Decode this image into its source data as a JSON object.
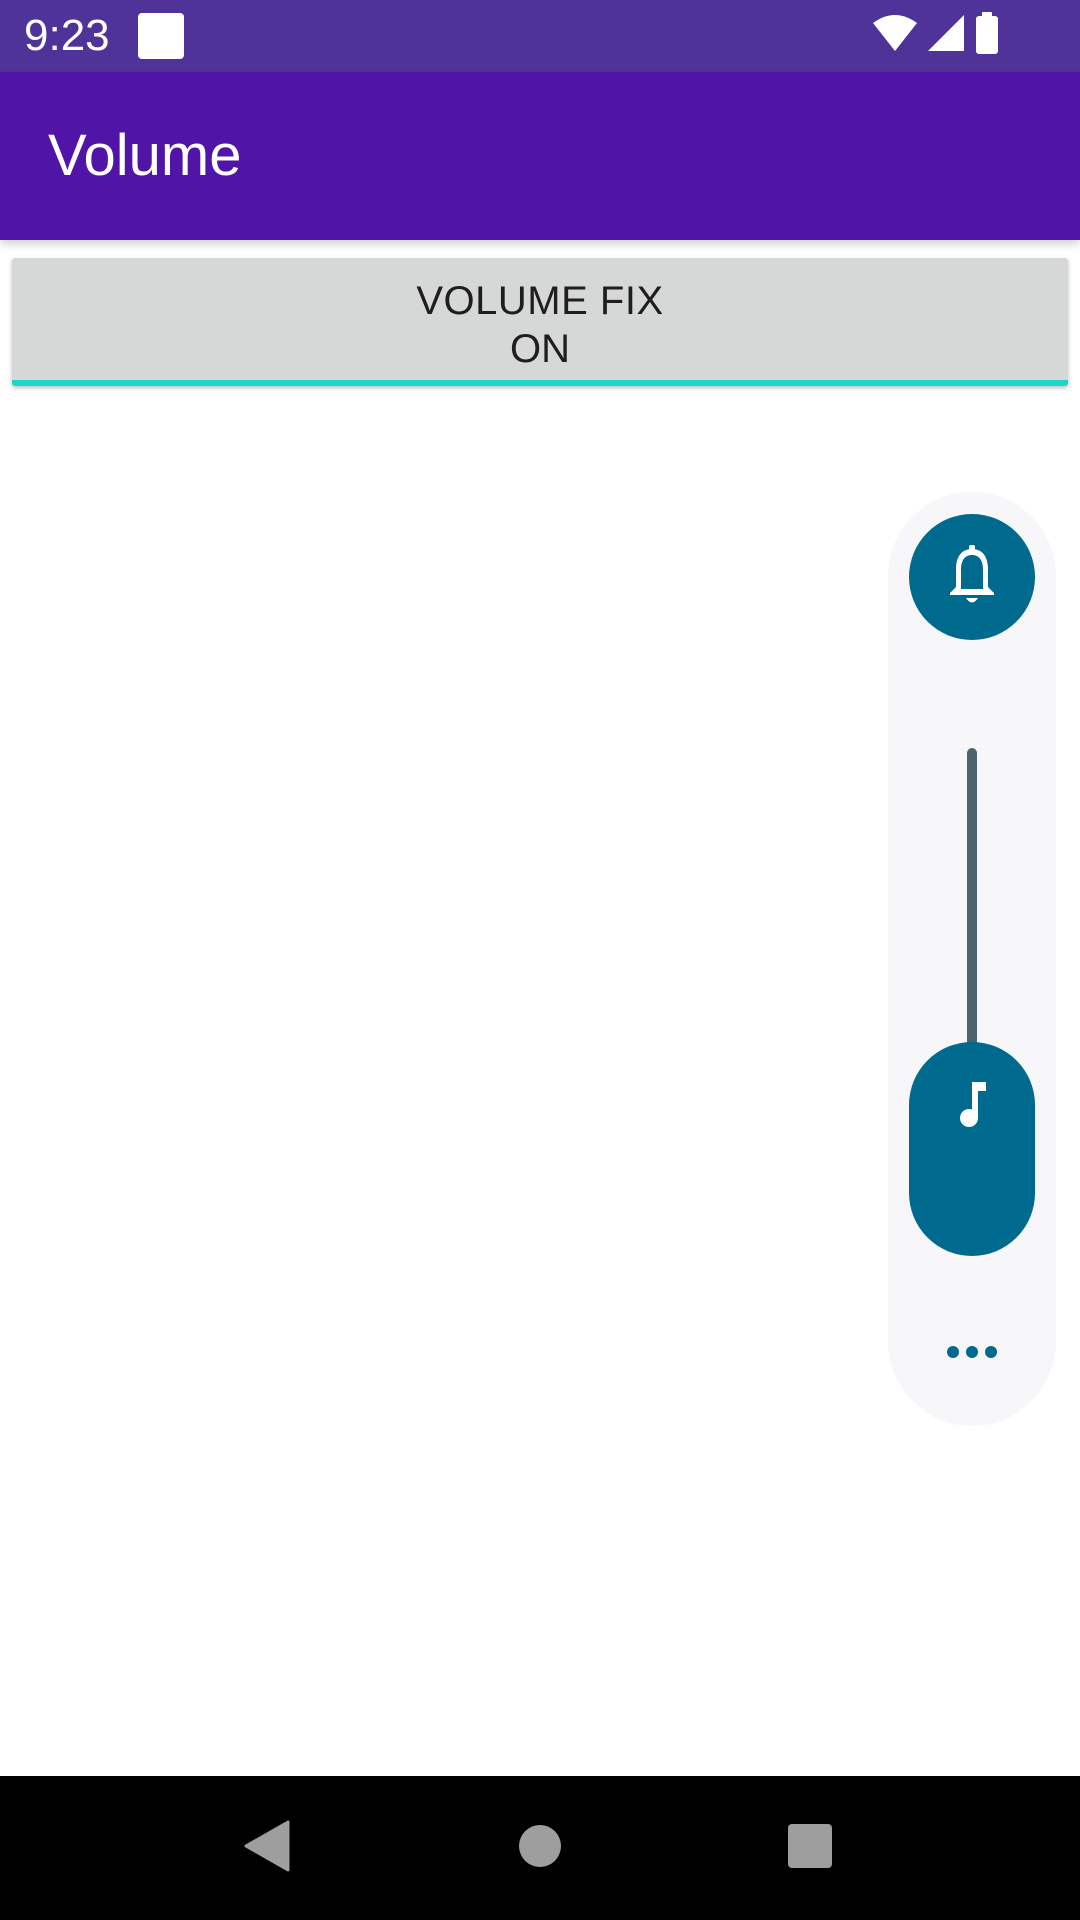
{
  "status_bar": {
    "time": "9:23",
    "icons": [
      "notification-square-icon",
      "wifi-icon",
      "cellular-signal-icon",
      "battery-icon"
    ]
  },
  "app_bar": {
    "title": "Volume"
  },
  "volume_fix_button": {
    "label": "VOLUME FIX",
    "state": "ON",
    "indicator_color": "#1ed6c8"
  },
  "volume_panel": {
    "ringer_icon": "bell-icon",
    "stream_icon": "music-note-icon",
    "more_icon": "more-horizontal-icon",
    "media_volume_level": 0.0
  },
  "nav_bar": {
    "buttons": [
      "back-icon",
      "home-icon",
      "recents-icon"
    ]
  },
  "colors": {
    "status_bar": "#4f3399",
    "app_bar": "#5014a6",
    "accent": "#006a8e",
    "track": "#4e626d",
    "panel": "#f7f7f9",
    "button_bg": "#d6d7d7"
  }
}
